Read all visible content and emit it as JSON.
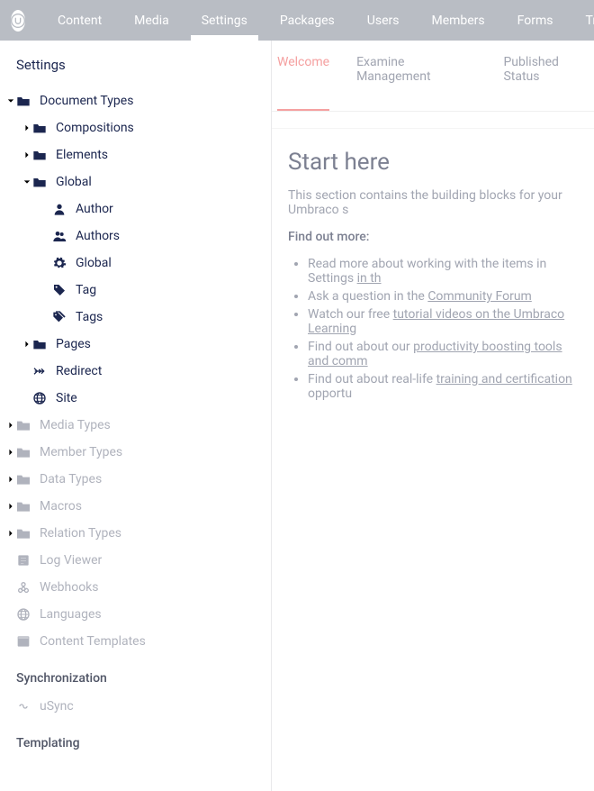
{
  "topnav": [
    "Content",
    "Media",
    "Settings",
    "Packages",
    "Users",
    "Members",
    "Forms",
    "Translation"
  ],
  "topnav_active": 2,
  "sidebar_title": "Settings",
  "tree": [
    {
      "level": 0,
      "caret": "down",
      "icon": "folder",
      "label": "Document Types",
      "dim": false
    },
    {
      "level": 1,
      "caret": "right",
      "icon": "folder",
      "label": "Compositions",
      "dim": false
    },
    {
      "level": 1,
      "caret": "right",
      "icon": "folder",
      "label": "Elements",
      "dim": false
    },
    {
      "level": 1,
      "caret": "down",
      "icon": "folder",
      "label": "Global",
      "dim": false
    },
    {
      "level": 2,
      "caret": "",
      "icon": "user",
      "label": "Author",
      "dim": false
    },
    {
      "level": 2,
      "caret": "",
      "icon": "users",
      "label": "Authors",
      "dim": false
    },
    {
      "level": 2,
      "caret": "",
      "icon": "gear",
      "label": "Global",
      "dim": false
    },
    {
      "level": 2,
      "caret": "",
      "icon": "tag",
      "label": "Tag",
      "dim": false
    },
    {
      "level": 2,
      "caret": "",
      "icon": "tags",
      "label": "Tags",
      "dim": false
    },
    {
      "level": 1,
      "caret": "right",
      "icon": "folder",
      "label": "Pages",
      "dim": false
    },
    {
      "level": 1,
      "caret": "",
      "icon": "redirect",
      "label": "Redirect",
      "dim": false
    },
    {
      "level": 1,
      "caret": "",
      "icon": "globe",
      "label": "Site",
      "dim": false
    },
    {
      "level": 0,
      "caret": "right",
      "icon": "folder",
      "label": "Media Types",
      "dim": true
    },
    {
      "level": 0,
      "caret": "right",
      "icon": "folder",
      "label": "Member Types",
      "dim": true
    },
    {
      "level": 0,
      "caret": "right",
      "icon": "folder",
      "label": "Data Types",
      "dim": true
    },
    {
      "level": 0,
      "caret": "right",
      "icon": "folder",
      "label": "Macros",
      "dim": true
    },
    {
      "level": 0,
      "caret": "right",
      "icon": "folder",
      "label": "Relation Types",
      "dim": true
    },
    {
      "level": 0,
      "caret": "",
      "icon": "log",
      "label": "Log Viewer",
      "dim": true
    },
    {
      "level": 0,
      "caret": "",
      "icon": "webhook",
      "label": "Webhooks",
      "dim": true
    },
    {
      "level": 0,
      "caret": "",
      "icon": "globe",
      "label": "Languages",
      "dim": true
    },
    {
      "level": 0,
      "caret": "",
      "icon": "template",
      "label": "Content Templates",
      "dim": true
    }
  ],
  "section_sync": "Synchronization",
  "sync_items": [
    {
      "level": 0,
      "caret": "",
      "icon": "infinity",
      "label": "uSync",
      "dim": true
    }
  ],
  "section_templating": "Templating",
  "tabs": [
    "Welcome",
    "Examine Management",
    "Published Status"
  ],
  "tabs_active": 0,
  "panel": {
    "title": "Start here",
    "intro": "This section contains the building blocks for your Umbraco s",
    "find_out": "Find out more:",
    "bullets": [
      {
        "pre": "Read more about working with the items in Settings ",
        "link": "in th",
        "post": ""
      },
      {
        "pre": "Ask a question in the ",
        "link": "Community Forum",
        "post": ""
      },
      {
        "pre": "Watch our free ",
        "link": "tutorial videos on the Umbraco Learning",
        "post": ""
      },
      {
        "pre": "Find out about our ",
        "link": "productivity boosting tools and comm",
        "post": ""
      },
      {
        "pre": "Find out about real-life ",
        "link": "training and certification",
        "post": " opportu"
      }
    ]
  }
}
